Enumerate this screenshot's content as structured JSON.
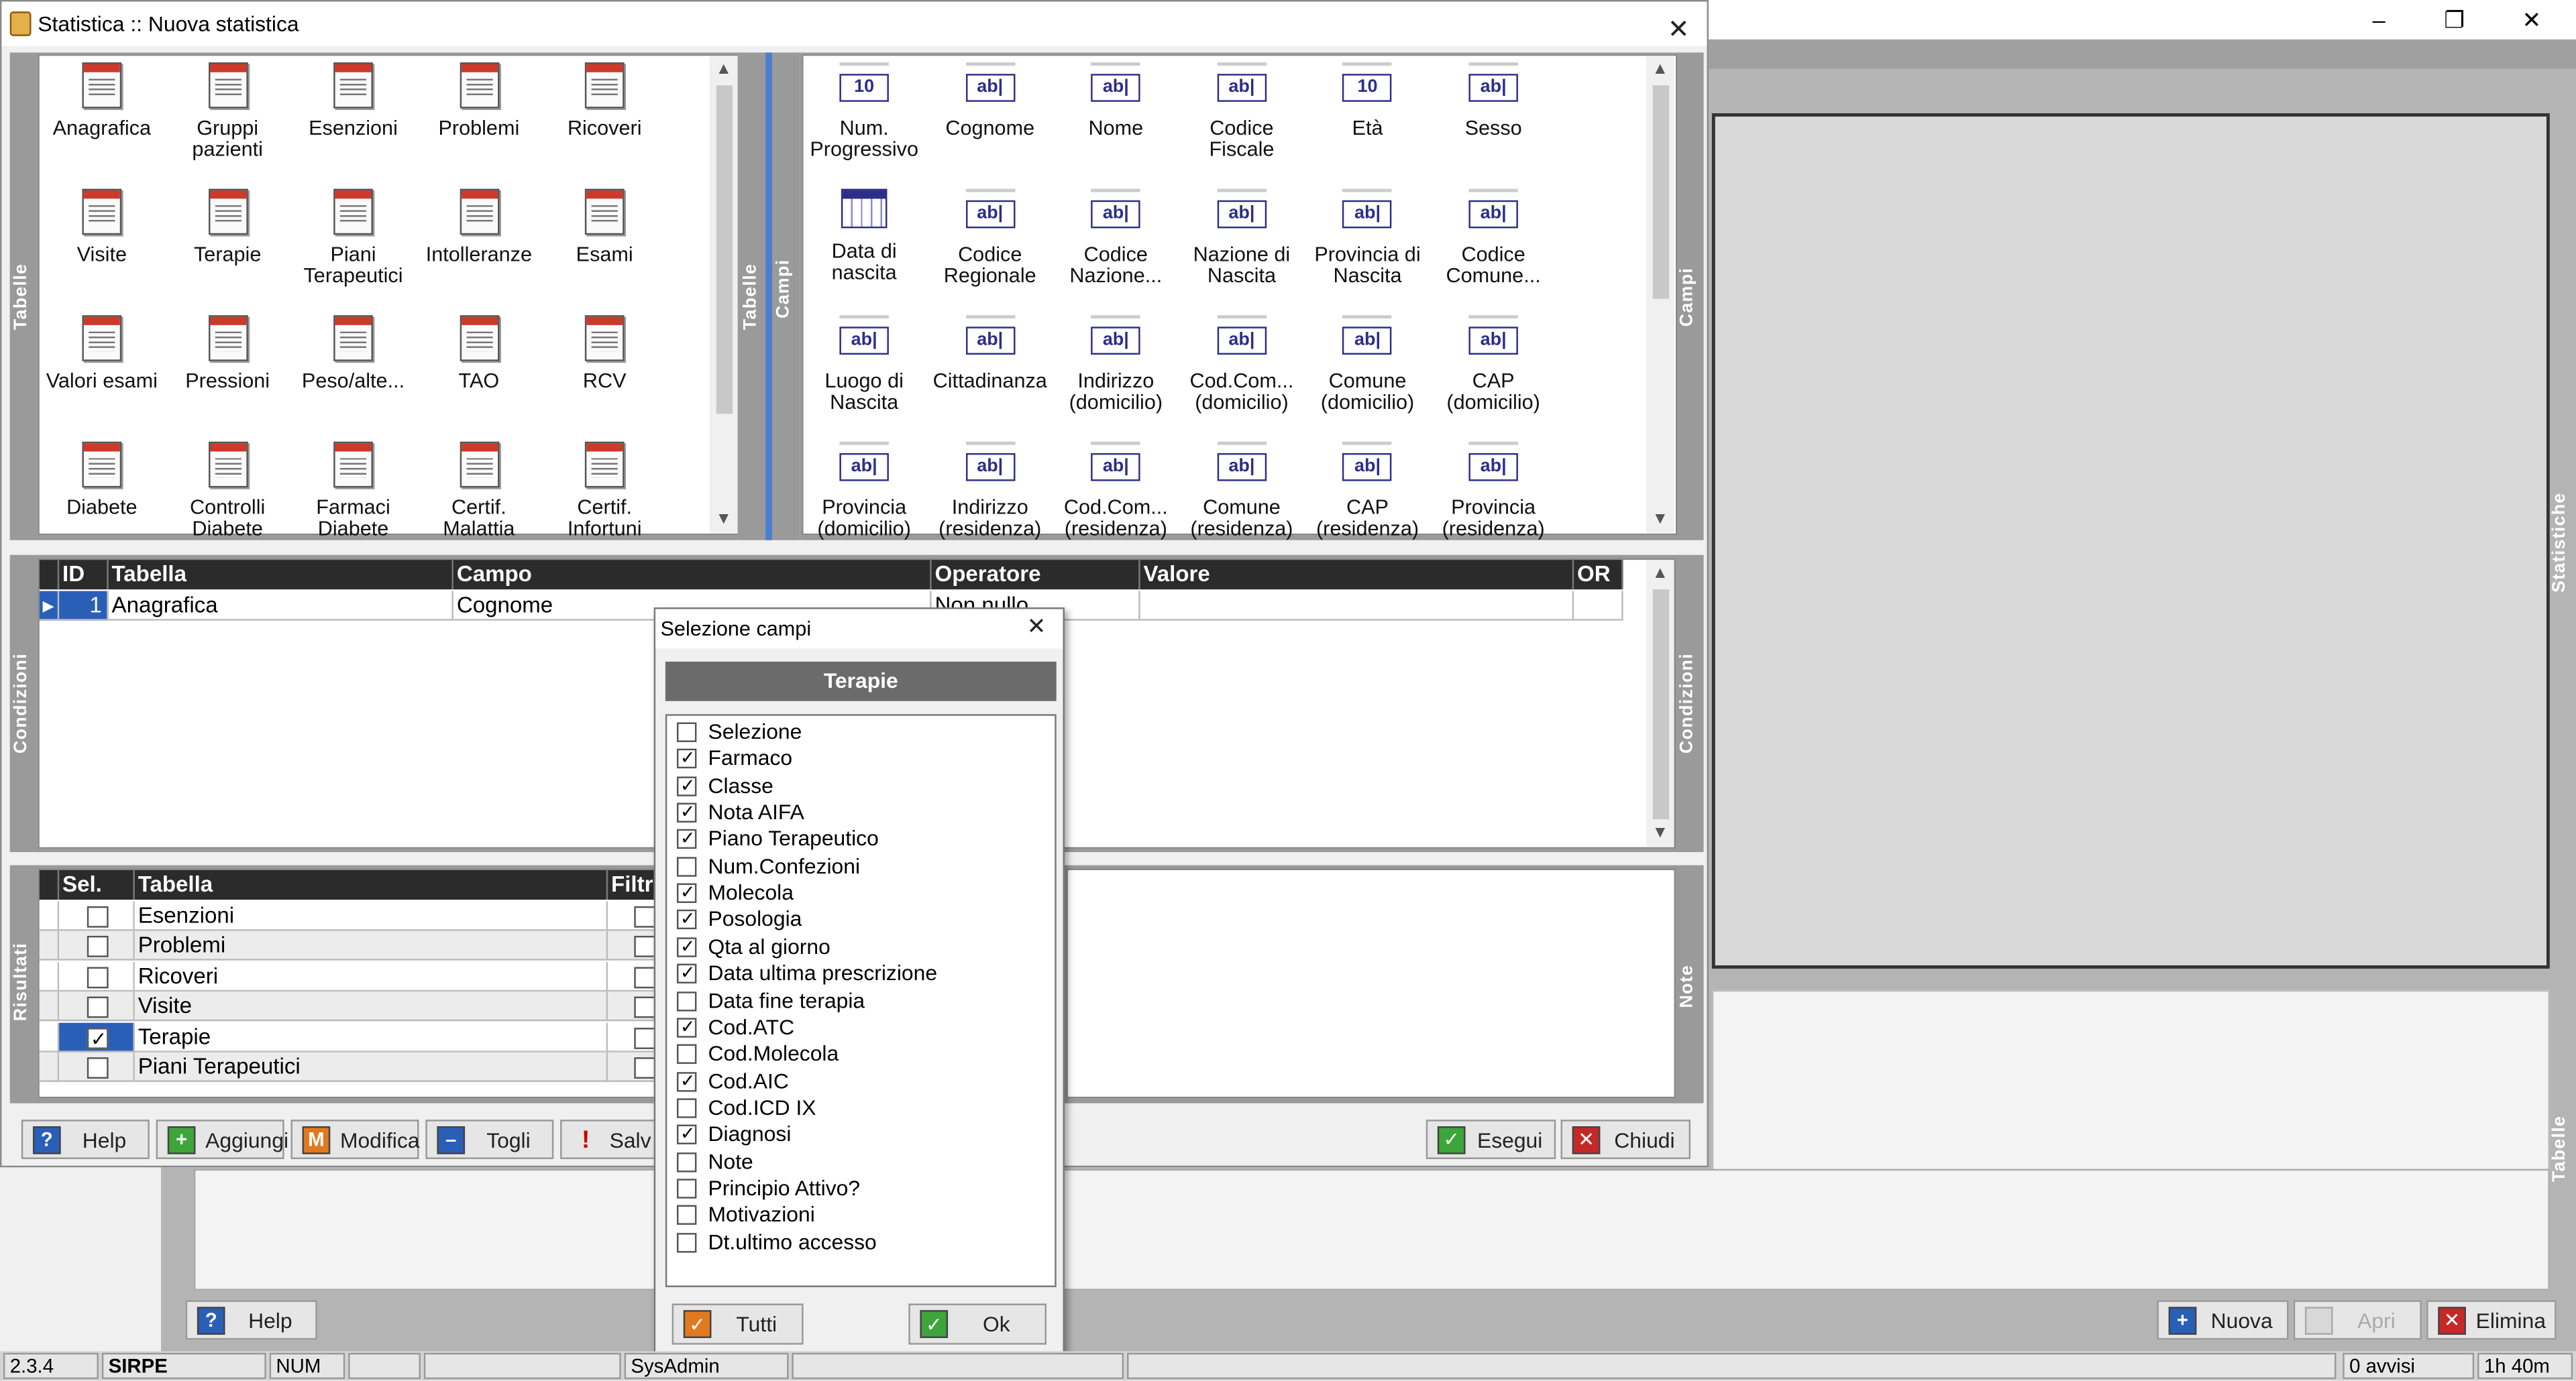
{
  "main_window": {
    "controls": {
      "minimize": "–",
      "maximize": "❐",
      "close": "✕"
    },
    "vertical_tabs": {
      "statistiche": "Statistiche",
      "tabelle": "Tabelle"
    },
    "buttons": {
      "help": "Help",
      "nuova": "Nuova",
      "apri": "Apri",
      "elimina": "Elimina"
    }
  },
  "dialog": {
    "title": "Statistica :: Nuova statistica",
    "close": "✕",
    "tables_tab": "Tabelle",
    "fields_tab_left": "Tabelle",
    "fields_tab_right": "Campi",
    "fields_tab_right_edge": "Campi",
    "conditions_tab": "Condizioni",
    "conditions_tab_right": "Condizioni",
    "results_tab": "Risultati",
    "note_tab": "Note",
    "tables": [
      "Anagrafica",
      "Gruppi pazienti",
      "Esenzioni",
      "Problemi",
      "Ricoveri",
      "Visite",
      "Terapie",
      "Piani Terapeutici",
      "Intolleranze",
      "Esami",
      "Valori esami",
      "Pressioni",
      "Peso/alte...",
      "TAO",
      "RCV",
      "Diabete",
      "Controlli Diabete",
      "Farmaci Diabete",
      "Certif. Malattia",
      "Certif. Infortuni"
    ],
    "fields": [
      {
        "label": "Num. Progressivo",
        "icon": "num-field-icon",
        "glyph": "10"
      },
      {
        "label": "Cognome",
        "icon": "text-field-icon",
        "glyph": "ab|"
      },
      {
        "label": "Nome",
        "icon": "text-field-icon",
        "glyph": "ab|"
      },
      {
        "label": "Codice Fiscale",
        "icon": "text-field-icon",
        "glyph": "ab|"
      },
      {
        "label": "Età",
        "icon": "num-field-icon",
        "glyph": "10"
      },
      {
        "label": "Sesso",
        "icon": "text-field-icon",
        "glyph": "ab|"
      },
      {
        "label": "Data di nascita",
        "icon": "calendar-icon",
        "glyph": ""
      },
      {
        "label": "Codice Regionale",
        "icon": "text-field-icon",
        "glyph": "ab|"
      },
      {
        "label": "Codice Nazione...",
        "icon": "text-field-icon",
        "glyph": "ab|"
      },
      {
        "label": "Nazione di Nascita",
        "icon": "text-field-icon",
        "glyph": "ab|"
      },
      {
        "label": "Provincia di Nascita",
        "icon": "text-field-icon",
        "glyph": "ab|"
      },
      {
        "label": "Codice Comune...",
        "icon": "text-field-icon",
        "glyph": "ab|"
      },
      {
        "label": "Luogo di Nascita",
        "icon": "text-field-icon",
        "glyph": "ab|"
      },
      {
        "label": "Cittadinanza",
        "icon": "text-field-icon",
        "glyph": "ab|"
      },
      {
        "label": "Indirizzo (domicilio)",
        "icon": "text-field-icon",
        "glyph": "ab|"
      },
      {
        "label": "Cod.Com... (domicilio)",
        "icon": "text-field-icon",
        "glyph": "ab|"
      },
      {
        "label": "Comune (domicilio)",
        "icon": "text-field-icon",
        "glyph": "ab|"
      },
      {
        "label": "CAP (domicilio)",
        "icon": "text-field-icon",
        "glyph": "ab|"
      },
      {
        "label": "Provincia (domicilio)",
        "icon": "text-field-icon",
        "glyph": "ab|"
      },
      {
        "label": "Indirizzo (residenza)",
        "icon": "text-field-icon",
        "glyph": "ab|"
      },
      {
        "label": "Cod.Com... (residenza)",
        "icon": "text-field-icon",
        "glyph": "ab|"
      },
      {
        "label": "Comune (residenza)",
        "icon": "text-field-icon",
        "glyph": "ab|"
      },
      {
        "label": "CAP (residenza)",
        "icon": "text-field-icon",
        "glyph": "ab|"
      },
      {
        "label": "Provincia (residenza)",
        "icon": "text-field-icon",
        "glyph": "ab|"
      }
    ],
    "conditions": {
      "headers": {
        "id": "ID",
        "tabella": "Tabella",
        "campo": "Campo",
        "operatore": "Operatore",
        "valore": "Valore",
        "or": "OR"
      },
      "rows": [
        {
          "id": "1",
          "tabella": "Anagrafica",
          "campo": "Cognome",
          "operatore": "Non nullo",
          "valore": "",
          "or": ""
        }
      ]
    },
    "results": {
      "headers": {
        "sel": "Sel.",
        "tabella": "Tabella",
        "filtro": "Filtr"
      },
      "rows": [
        {
          "tabella": "Esenzioni",
          "selected": false
        },
        {
          "tabella": "Problemi",
          "selected": false
        },
        {
          "tabella": "Ricoveri",
          "selected": false
        },
        {
          "tabella": "Visite",
          "selected": false
        },
        {
          "tabella": "Terapie",
          "selected": true
        },
        {
          "tabella": "Piani Terapeutici",
          "selected": false
        }
      ]
    },
    "buttons": {
      "help": "Help",
      "aggiungi": "Aggiungi",
      "modifica": "Modifica",
      "togli": "Togli",
      "salva": "Salv",
      "esegui": "Esegui",
      "chiudi": "Chiudi"
    }
  },
  "popup": {
    "title": "Selezione campi",
    "close": "✕",
    "header": "Terapie",
    "items": [
      {
        "label": "Selezione",
        "checked": false
      },
      {
        "label": "Farmaco",
        "checked": true
      },
      {
        "label": "Classe",
        "checked": true
      },
      {
        "label": "Nota AIFA",
        "checked": true
      },
      {
        "label": "Piano Terapeutico",
        "checked": true
      },
      {
        "label": "Num.Confezioni",
        "checked": false
      },
      {
        "label": "Molecola",
        "checked": true
      },
      {
        "label": "Posologia",
        "checked": true
      },
      {
        "label": "Qta al giorno",
        "checked": true
      },
      {
        "label": "Data ultima prescrizione",
        "checked": true
      },
      {
        "label": "Data fine terapia",
        "checked": false
      },
      {
        "label": "Cod.ATC",
        "checked": true
      },
      {
        "label": "Cod.Molecola",
        "checked": false
      },
      {
        "label": "Cod.AIC",
        "checked": true
      },
      {
        "label": "Cod.ICD IX",
        "checked": false
      },
      {
        "label": "Diagnosi",
        "checked": true
      },
      {
        "label": "Note",
        "checked": false
      },
      {
        "label": "Principio Attivo?",
        "checked": false
      },
      {
        "label": "Motivazioni",
        "checked": false
      },
      {
        "label": "Dt.ultimo accesso",
        "checked": false
      }
    ],
    "buttons": {
      "tutti": "Tutti",
      "ok": "Ok"
    }
  },
  "status_bar": {
    "version": "2.3.4",
    "app": "SIRPE",
    "num": "NUM",
    "user": "SysAdmin",
    "avvisi": "0 avvisi",
    "time": "1h 40m"
  },
  "colors": {
    "accent_blue": "#2a5fb8",
    "dark_header": "#2b2b2b",
    "ok_green": "#3da53a",
    "close_red": "#c62828"
  }
}
